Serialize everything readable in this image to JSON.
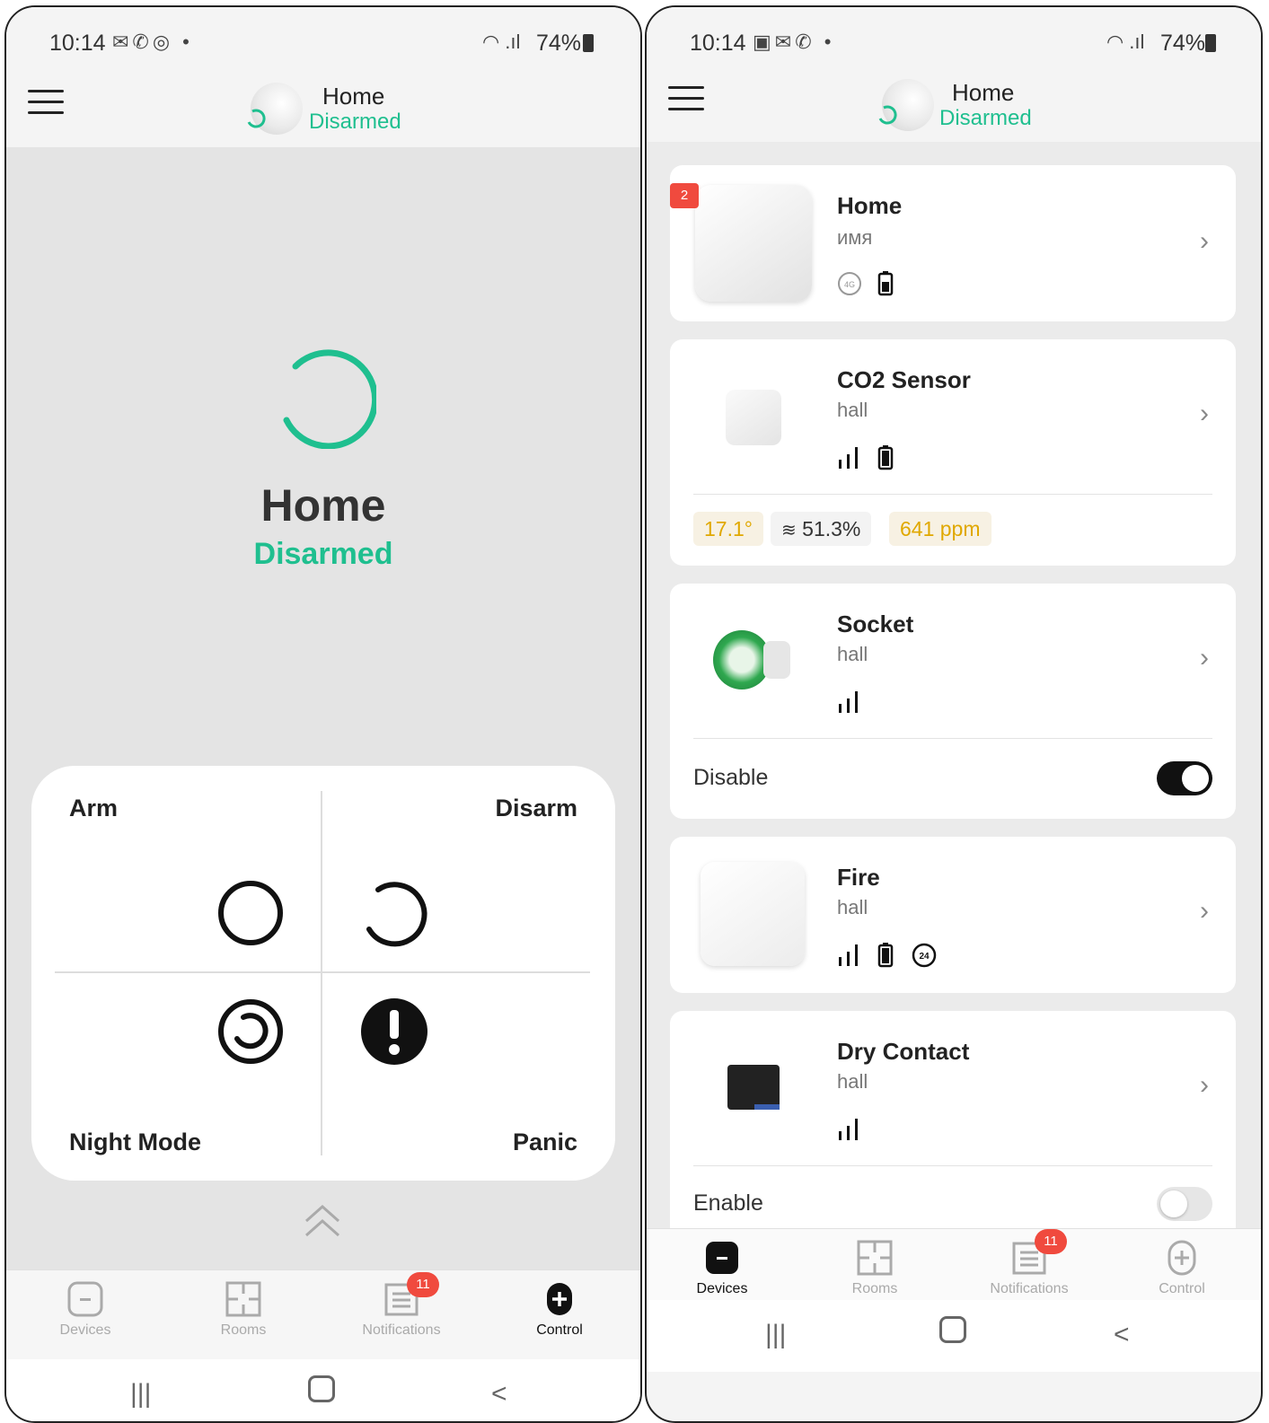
{
  "left_phone": {
    "status_bar": {
      "time": "10:14",
      "battery": "74%"
    },
    "header": {
      "title": "Home",
      "status": "Disarmed"
    },
    "hero": {
      "title": "Home",
      "status": "Disarmed"
    },
    "control": {
      "arm": "Arm",
      "disarm": "Disarm",
      "night_mode": "Night Mode",
      "panic": "Panic"
    },
    "nav": {
      "devices": "Devices",
      "rooms": "Rooms",
      "notifications": "Notifications",
      "control": "Control",
      "notifications_badge": "11",
      "active": "Control"
    }
  },
  "right_phone": {
    "status_bar": {
      "time": "10:14",
      "battery": "74%"
    },
    "header": {
      "title": "Home",
      "status": "Disarmed"
    },
    "devices": [
      {
        "name": "Home",
        "room": "имя",
        "badge": "2"
      },
      {
        "name": "CO2 Sensor",
        "room": "hall",
        "temperature": "17.1°",
        "humidity": "51.3%",
        "co2": "641 ppm"
      },
      {
        "name": "Socket",
        "room": "hall",
        "action_label": "Disable",
        "toggle_on": true
      },
      {
        "name": "Fire",
        "room": "hall"
      },
      {
        "name": "Dry Contact",
        "room": "hall",
        "action_label": "Enable",
        "toggle_on": false
      }
    ],
    "nav": {
      "devices": "Devices",
      "rooms": "Rooms",
      "notifications": "Notifications",
      "control": "Control",
      "notifications_badge": "11",
      "active": "Devices"
    }
  },
  "colors": {
    "accent_green": "#1fbf8f",
    "badge_red": "#f04a3e",
    "chip_yellow": "#e0a800"
  }
}
